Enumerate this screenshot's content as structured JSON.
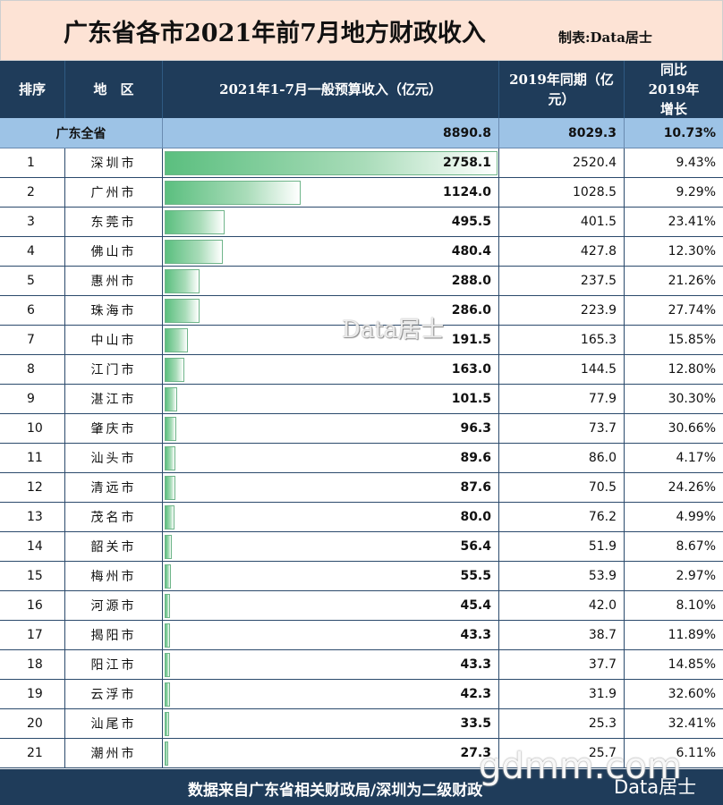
{
  "title": "广东省各市2021年前7月地方财政收入",
  "credit": "制表:Data居士",
  "headers": {
    "rank": "排序",
    "region": "地　区",
    "revenue": "2021年1-7月一般预算收入（亿元）",
    "prior": "2019年同期（亿元）",
    "growth": "同比2019年增长"
  },
  "summary": {
    "label": "广东全省",
    "revenue": "8890.8",
    "prior": "8029.3",
    "growth": "10.73%"
  },
  "chart_data": {
    "type": "table",
    "title": "广东省各市2021年前7月地方财政收入",
    "columns": [
      "排序",
      "地　区",
      "2021年1-7月一般预算收入（亿元）",
      "2019年同期（亿元）",
      "同比2019年增长"
    ],
    "rows": [
      {
        "rank": "1",
        "city": "深圳市",
        "revenue": 2758.1,
        "prior": "2520.4",
        "growth": "9.43%"
      },
      {
        "rank": "2",
        "city": "广州市",
        "revenue": 1124.0,
        "prior": "1028.5",
        "growth": "9.29%"
      },
      {
        "rank": "3",
        "city": "东莞市",
        "revenue": 495.5,
        "prior": "401.5",
        "growth": "23.41%"
      },
      {
        "rank": "4",
        "city": "佛山市",
        "revenue": 480.4,
        "prior": "427.8",
        "growth": "12.30%"
      },
      {
        "rank": "5",
        "city": "惠州市",
        "revenue": 288.0,
        "prior": "237.5",
        "growth": "21.26%"
      },
      {
        "rank": "6",
        "city": "珠海市",
        "revenue": 286.0,
        "prior": "223.9",
        "growth": "27.74%"
      },
      {
        "rank": "7",
        "city": "中山市",
        "revenue": 191.5,
        "prior": "165.3",
        "growth": "15.85%"
      },
      {
        "rank": "8",
        "city": "江门市",
        "revenue": 163.0,
        "prior": "144.5",
        "growth": "12.80%"
      },
      {
        "rank": "9",
        "city": "湛江市",
        "revenue": 101.5,
        "prior": "77.9",
        "growth": "30.30%"
      },
      {
        "rank": "10",
        "city": "肇庆市",
        "revenue": 96.3,
        "prior": "73.7",
        "growth": "30.66%"
      },
      {
        "rank": "11",
        "city": "汕头市",
        "revenue": 89.6,
        "prior": "86.0",
        "growth": "4.17%"
      },
      {
        "rank": "12",
        "city": "清远市",
        "revenue": 87.6,
        "prior": "70.5",
        "growth": "24.26%"
      },
      {
        "rank": "13",
        "city": "茂名市",
        "revenue": 80.0,
        "prior": "76.2",
        "growth": "4.99%"
      },
      {
        "rank": "14",
        "city": "韶关市",
        "revenue": 56.4,
        "prior": "51.9",
        "growth": "8.67%"
      },
      {
        "rank": "15",
        "city": "梅州市",
        "revenue": 55.5,
        "prior": "53.9",
        "growth": "2.97%"
      },
      {
        "rank": "16",
        "city": "河源市",
        "revenue": 45.4,
        "prior": "42.0",
        "growth": "8.10%"
      },
      {
        "rank": "17",
        "city": "揭阳市",
        "revenue": 43.3,
        "prior": "38.7",
        "growth": "11.89%"
      },
      {
        "rank": "18",
        "city": "阳江市",
        "revenue": 43.3,
        "prior": "37.7",
        "growth": "14.85%"
      },
      {
        "rank": "19",
        "city": "云浮市",
        "revenue": 42.3,
        "prior": "31.9",
        "growth": "32.60%"
      },
      {
        "rank": "20",
        "city": "汕尾市",
        "revenue": 33.5,
        "prior": "25.3",
        "growth": "32.41%"
      },
      {
        "rank": "21",
        "city": "潮州市",
        "revenue": 27.3,
        "prior": "25.7",
        "growth": "6.11%"
      }
    ]
  },
  "footer": {
    "source": "数据来自广东省相关财政局/深圳为二级财政",
    "mark": "Data居士"
  },
  "watermarks": {
    "center": "Data居士",
    "site": "gdmm.com"
  }
}
